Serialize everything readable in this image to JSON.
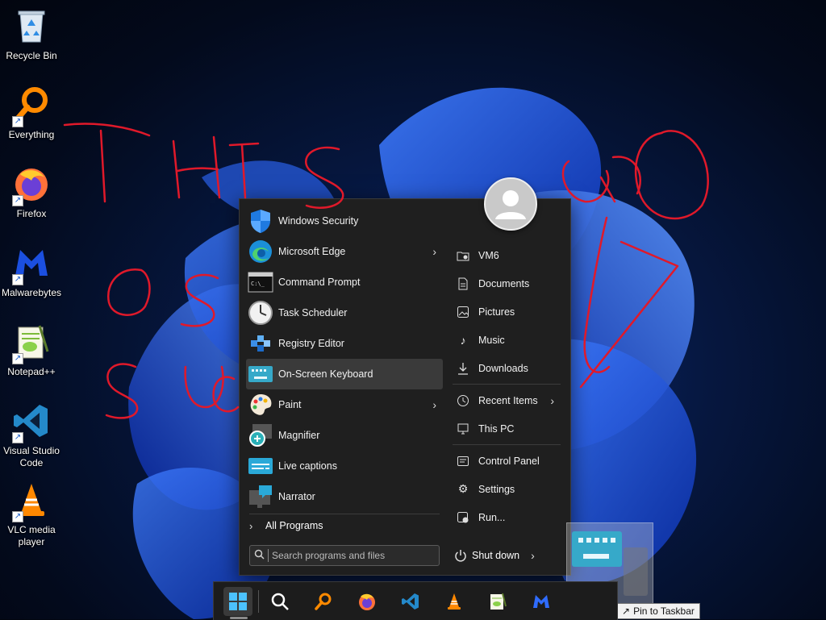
{
  "desktop": {
    "icons": [
      {
        "label": "Recycle Bin",
        "icon": "recycle-bin-icon"
      },
      {
        "label": "Everything",
        "icon": "everything-search-icon"
      },
      {
        "label": "Firefox",
        "icon": "firefox-icon"
      },
      {
        "label": "Malwarebytes",
        "icon": "malwarebytes-icon"
      },
      {
        "label": "Notepad++",
        "icon": "notepad-plus-plus-icon"
      },
      {
        "label": "Visual Studio Code",
        "icon": "vscode-icon"
      },
      {
        "label": "VLC media player",
        "icon": "vlc-icon"
      }
    ]
  },
  "start_menu": {
    "apps": [
      {
        "label": "Windows Security",
        "icon": "windows-security-icon",
        "has_submenu": false
      },
      {
        "label": "Microsoft Edge",
        "icon": "edge-icon",
        "has_submenu": true
      },
      {
        "label": "Command Prompt",
        "icon": "command-prompt-icon",
        "has_submenu": false
      },
      {
        "label": "Task Scheduler",
        "icon": "task-scheduler-icon",
        "has_submenu": false
      },
      {
        "label": "Registry Editor",
        "icon": "registry-editor-icon",
        "has_submenu": false
      },
      {
        "label": "On-Screen Keyboard",
        "icon": "on-screen-keyboard-icon",
        "has_submenu": false,
        "highlighted": true
      },
      {
        "label": "Paint",
        "icon": "paint-icon",
        "has_submenu": true
      },
      {
        "label": "Magnifier",
        "icon": "magnifier-icon",
        "has_submenu": false
      },
      {
        "label": "Live captions",
        "icon": "live-captions-icon",
        "has_submenu": false
      },
      {
        "label": "Narrator",
        "icon": "narrator-icon",
        "has_submenu": false
      }
    ],
    "all_programs": "All Programs",
    "search_placeholder": "Search programs and files",
    "places": [
      {
        "label": "VM6",
        "icon": "user-folder-icon"
      },
      {
        "label": "Documents",
        "icon": "documents-icon"
      },
      {
        "label": "Pictures",
        "icon": "pictures-icon"
      },
      {
        "label": "Music",
        "icon": "music-icon"
      },
      {
        "label": "Downloads",
        "icon": "downloads-icon"
      },
      {
        "label": "Recent Items",
        "icon": "recent-items-icon",
        "has_submenu": true
      },
      {
        "label": "This PC",
        "icon": "this-pc-icon"
      },
      {
        "label": "Control Panel",
        "icon": "control-panel-icon"
      },
      {
        "label": "Settings",
        "icon": "settings-icon"
      },
      {
        "label": "Run...",
        "icon": "run-icon"
      }
    ],
    "shutdown": "Shut down"
  },
  "drag": {
    "tooltip": "Pin to Taskbar",
    "tooltip_glyph": "↗"
  },
  "taskbar": {
    "items": [
      "start-icon",
      "search-icon",
      "everything-search-icon",
      "firefox-icon",
      "vscode-icon",
      "vlc-icon",
      "notepad-plus-plus-icon",
      "malwarebytes-icon"
    ]
  },
  "annotation": {
    "text": "THIS OS SUCKS",
    "color": "#e0192a"
  }
}
